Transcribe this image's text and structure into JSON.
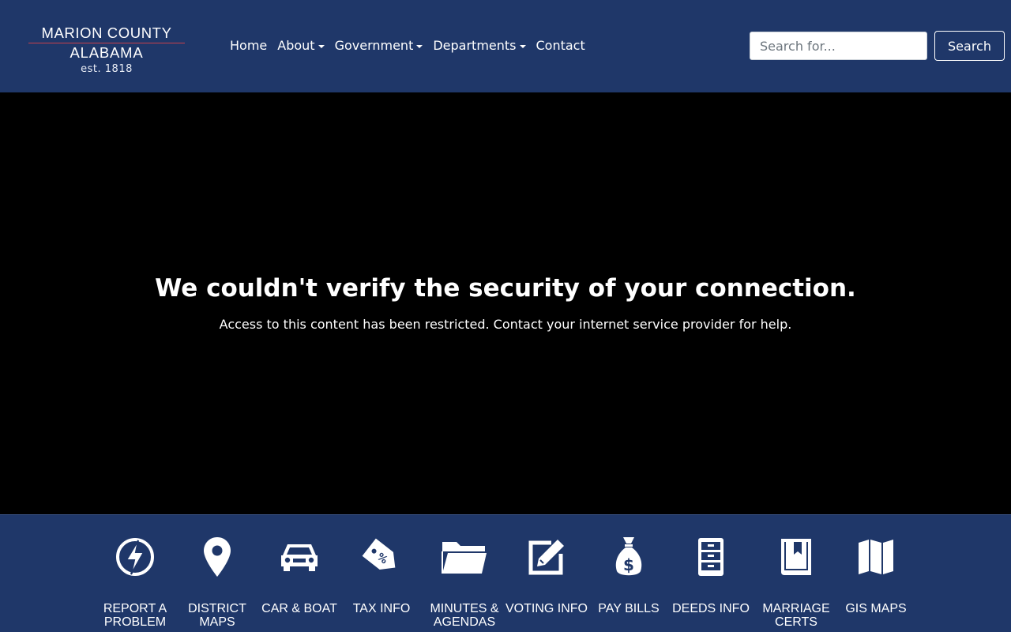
{
  "header": {
    "logo": {
      "line1": "MARION COUNTY",
      "line2": "ALABAMA",
      "line3": "est. 1818"
    },
    "nav": [
      {
        "label": "Home",
        "dropdown": false
      },
      {
        "label": "About",
        "dropdown": true
      },
      {
        "label": "Government",
        "dropdown": true
      },
      {
        "label": "Departments",
        "dropdown": true
      },
      {
        "label": "Contact",
        "dropdown": false
      }
    ],
    "search": {
      "placeholder": "Search for...",
      "value": "",
      "button_label": "Search"
    }
  },
  "main": {
    "heading": "We couldn't verify the security of your connection.",
    "message": "Access to this content has been restricted. Contact your internet service provider for help."
  },
  "quick_links": [
    {
      "label": "REPORT A PROBLEM",
      "icon": "lightning-icon"
    },
    {
      "label": "DISTRICT MAPS",
      "icon": "map-pin-icon"
    },
    {
      "label": "CAR & BOAT",
      "icon": "car-icon"
    },
    {
      "label": "TAX INFO",
      "icon": "price-tag-icon"
    },
    {
      "label": "MINUTES & AGENDAS",
      "icon": "folder-icon"
    },
    {
      "label": "VOTING INFO",
      "icon": "edit-icon"
    },
    {
      "label": "PAY BILLS",
      "icon": "money-bag-icon"
    },
    {
      "label": "DEEDS INFO",
      "icon": "file-cabinet-icon"
    },
    {
      "label": "MARRIAGE CERTS",
      "icon": "book-icon"
    },
    {
      "label": "GIS MAPS",
      "icon": "map-icon"
    }
  ],
  "colors": {
    "header_bg": "#1f3769",
    "main_bg": "#000000",
    "accent_rule": "#c8414b"
  }
}
